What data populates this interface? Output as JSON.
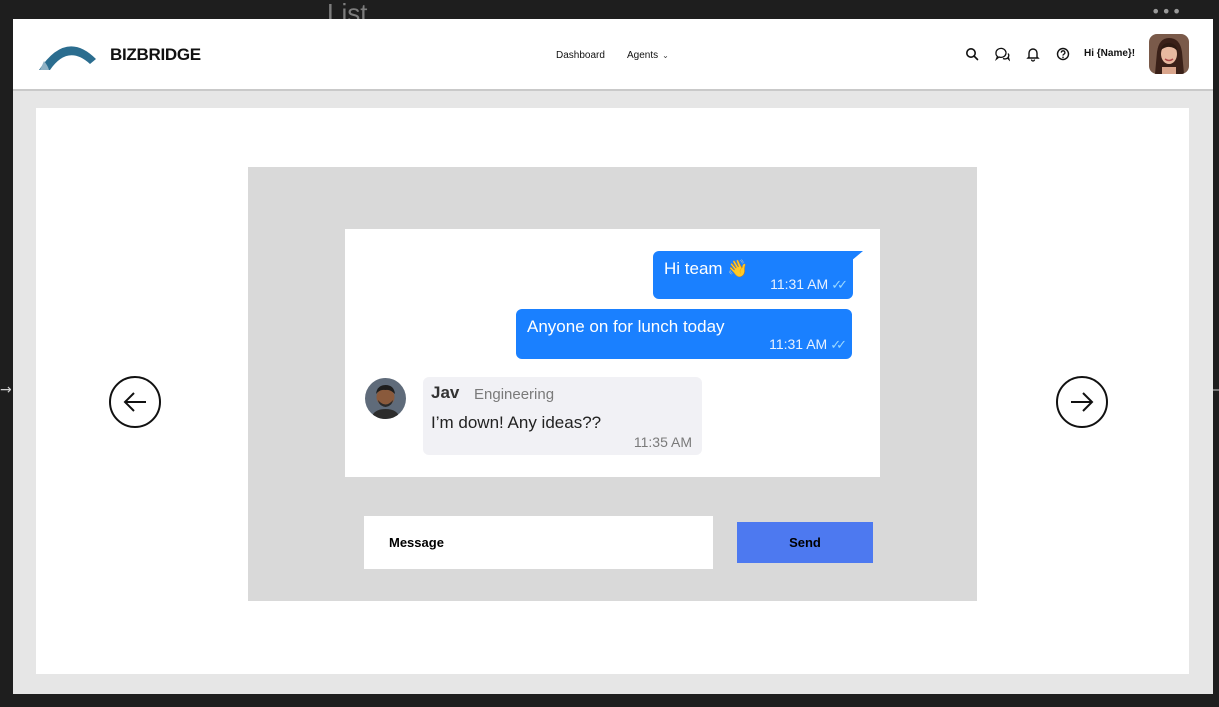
{
  "canvas": {
    "frame_label": "List",
    "more_glyph": "•••"
  },
  "header": {
    "brand": "BIZBRIDGE",
    "nav": {
      "dashboard": "Dashboard",
      "agents": "Agents"
    },
    "icons": [
      "search-icon",
      "chat-icon",
      "bell-icon",
      "help-icon"
    ],
    "greeting": "Hi {Name}!"
  },
  "chat": {
    "messages_out": [
      {
        "text": "Hi team 👋",
        "time": "11:31 AM"
      },
      {
        "text": "Anyone on for lunch today",
        "time": "11:31 AM"
      }
    ],
    "message_in": {
      "sender": "Jav",
      "department": "Engineering",
      "text": "I’m down! Any ideas??",
      "time": "11:35 AM"
    }
  },
  "composer": {
    "placeholder": "Message",
    "send_label": "Send"
  },
  "colors": {
    "accent_blue": "#1a80ff",
    "send_button": "#4d79f0",
    "panel": "#d9d9d9",
    "logo": "#2b6d8f"
  }
}
